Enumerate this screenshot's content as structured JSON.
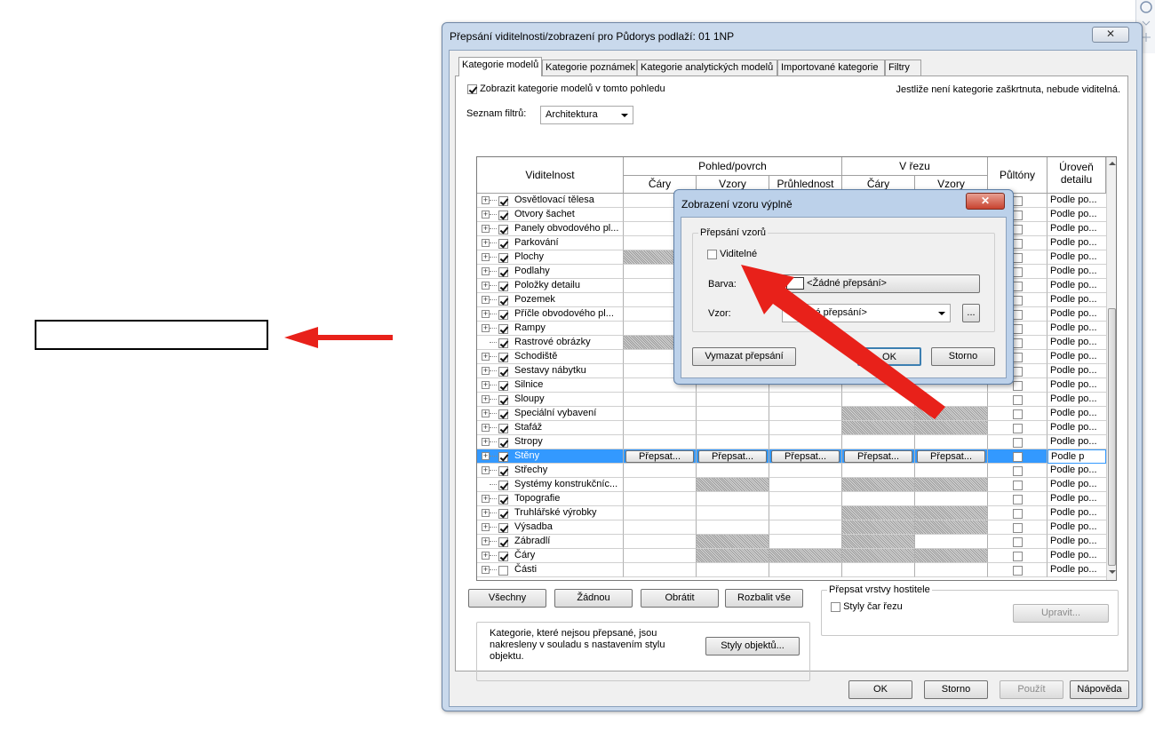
{
  "dialog": {
    "title": "Přepsání viditelnosti/zobrazení pro Půdorys podlaží: 01 1NP",
    "close_label": "✕",
    "tabs": [
      "Kategorie modelů",
      "Kategorie poznámek",
      "Kategorie analytických modelů",
      "Importované kategorie",
      "Filtry"
    ],
    "show_categories_label": "Zobrazit kategorie modelů v tomto pohledu",
    "hint": "Jestliže není kategorie zaškrtnuta, nebude viditelná.",
    "filter_list_label": "Seznam filtrů:",
    "filter_list_value": "Architektura"
  },
  "grid": {
    "headers": {
      "visibility": "Viditelnost",
      "view_surface": "Pohled/povrch",
      "cut": "V řezu",
      "halftone": "Půltóny",
      "detail_level": "Úroveň detailu",
      "lines": "Čáry",
      "patterns": "Vzory",
      "transparency": "Průhlednost",
      "cut_lines": "Čáry",
      "cut_patterns": "Vzory"
    },
    "detail_value": "Podle po...",
    "override_label": "Přepsat...",
    "selected_detail": "Podle p",
    "rows": [
      {
        "name": "Osvětlovací tělesa",
        "checked": true,
        "plus": true
      },
      {
        "name": "Otvory šachet",
        "checked": true,
        "plus": true
      },
      {
        "name": "Panely obvodového pl...",
        "checked": true,
        "plus": true
      },
      {
        "name": "Parkování",
        "checked": true,
        "plus": true
      },
      {
        "name": "Plochy",
        "checked": true,
        "plus": true
      },
      {
        "name": "Podlahy",
        "checked": true,
        "plus": true
      },
      {
        "name": "Položky detailu",
        "checked": true,
        "plus": true
      },
      {
        "name": "Pozemek",
        "checked": true,
        "plus": true
      },
      {
        "name": "Příčle obvodového pl...",
        "checked": true,
        "plus": true
      },
      {
        "name": "Rampy",
        "checked": true,
        "plus": true
      },
      {
        "name": "Rastrové obrázky",
        "checked": true,
        "plus": false
      },
      {
        "name": "Schodiště",
        "checked": true,
        "plus": true
      },
      {
        "name": "Sestavy nábytku",
        "checked": true,
        "plus": true
      },
      {
        "name": "Silnice",
        "checked": true,
        "plus": true
      },
      {
        "name": "Sloupy",
        "checked": true,
        "plus": true
      },
      {
        "name": "Speciální vybavení",
        "checked": true,
        "plus": true
      },
      {
        "name": "Stafáž",
        "checked": true,
        "plus": true
      },
      {
        "name": "Stropy",
        "checked": true,
        "plus": true
      },
      {
        "name": "Stěny",
        "checked": true,
        "plus": true,
        "selected": true
      },
      {
        "name": "Střechy",
        "checked": true,
        "plus": true
      },
      {
        "name": "Systémy konstrukčníc...",
        "checked": true,
        "plus": false
      },
      {
        "name": "Topografie",
        "checked": true,
        "plus": true
      },
      {
        "name": "Truhlářské výrobky",
        "checked": true,
        "plus": true
      },
      {
        "name": "Výsadba",
        "checked": true,
        "plus": true
      },
      {
        "name": "Zábradlí",
        "checked": true,
        "plus": true
      },
      {
        "name": "Čáry",
        "checked": true,
        "plus": true
      },
      {
        "name": "Části",
        "checked": false,
        "plus": true
      }
    ]
  },
  "buttons": {
    "all": "Všechny",
    "none": "Žádnou",
    "invert": "Obrátit",
    "expand_all": "Rozbalit vše",
    "object_styles": "Styly objektů...",
    "edit": "Upravit...",
    "ok": "OK",
    "cancel": "Storno",
    "apply": "Použít",
    "help": "Nápověda"
  },
  "host_layers": {
    "legend": "Přepsat vrstvy hostitele",
    "cut_line_styles": "Styly čar řezu"
  },
  "info_text": "Kategorie, které nejsou přepsané, jsou nakresleny v souladu s nastavením stylu objektu.",
  "popup": {
    "title": "Zobrazení vzoru výplně",
    "close_label": "✕",
    "group_label": "Přepsání vzorů",
    "visible_label": "Viditelné",
    "color_label": "Barva:",
    "color_value": "<Žádné přepsání>",
    "pattern_label": "Vzor:",
    "pattern_value": "<Žádné přepsání>",
    "browse_label": "...",
    "clear_label": "Vymazat přepsání",
    "ok": "OK",
    "cancel": "Storno"
  },
  "colors": {
    "annotation_arrow": "#e8211a",
    "selection": "#3399ff"
  }
}
